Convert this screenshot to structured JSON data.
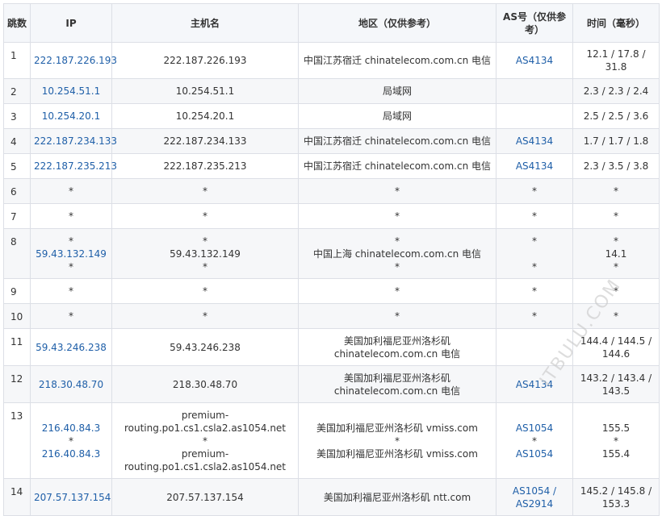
{
  "headers": {
    "hop": "跳数",
    "ip": "IP",
    "host": "主机名",
    "region": "地区（仅供参考）",
    "as": "AS号（仅供参考）",
    "time": "时间（毫秒）"
  },
  "rows": [
    {
      "hop": "1",
      "ip": [
        "222.187.226.193"
      ],
      "host": [
        "222.187.226.193"
      ],
      "region": [
        "中国江苏宿迁 chinatelecom.com.cn 电信"
      ],
      "as": [
        "AS4134"
      ],
      "time": [
        "12.1 / 17.8 / 31.8"
      ]
    },
    {
      "hop": "2",
      "ip": [
        "10.254.51.1"
      ],
      "host": [
        "10.254.51.1"
      ],
      "region": [
        "局域网"
      ],
      "as": [
        ""
      ],
      "time": [
        "2.3 / 2.3 / 2.4"
      ]
    },
    {
      "hop": "3",
      "ip": [
        "10.254.20.1"
      ],
      "host": [
        "10.254.20.1"
      ],
      "region": [
        "局域网"
      ],
      "as": [
        ""
      ],
      "time": [
        "2.5 / 2.5 / 3.6"
      ]
    },
    {
      "hop": "4",
      "ip": [
        "222.187.234.133"
      ],
      "host": [
        "222.187.234.133"
      ],
      "region": [
        "中国江苏宿迁 chinatelecom.com.cn 电信"
      ],
      "as": [
        "AS4134"
      ],
      "time": [
        "1.7 / 1.7 / 1.8"
      ]
    },
    {
      "hop": "5",
      "ip": [
        "222.187.235.213"
      ],
      "host": [
        "222.187.235.213"
      ],
      "region": [
        "中国江苏宿迁 chinatelecom.com.cn 电信"
      ],
      "as": [
        "AS4134"
      ],
      "time": [
        "2.3 / 3.5 / 3.8"
      ]
    },
    {
      "hop": "6",
      "ip": [
        "*"
      ],
      "host": [
        "*"
      ],
      "region": [
        "*"
      ],
      "as": [
        "*"
      ],
      "time": [
        "*"
      ]
    },
    {
      "hop": "7",
      "ip": [
        "*"
      ],
      "host": [
        "*"
      ],
      "region": [
        "*"
      ],
      "as": [
        "*"
      ],
      "time": [
        "*"
      ]
    },
    {
      "hop": "8",
      "ip": [
        "*",
        "59.43.132.149",
        "*"
      ],
      "host": [
        "*",
        "59.43.132.149",
        "*"
      ],
      "region": [
        "*",
        "中国上海 chinatelecom.com.cn 电信",
        "*"
      ],
      "as": [
        "*",
        "",
        "*"
      ],
      "time": [
        "*",
        "14.1",
        "*"
      ]
    },
    {
      "hop": "9",
      "ip": [
        "*"
      ],
      "host": [
        "*"
      ],
      "region": [
        "*"
      ],
      "as": [
        "*"
      ],
      "time": [
        "*"
      ]
    },
    {
      "hop": "10",
      "ip": [
        "*"
      ],
      "host": [
        "*"
      ],
      "region": [
        "*"
      ],
      "as": [
        "*"
      ],
      "time": [
        "*"
      ]
    },
    {
      "hop": "11",
      "ip": [
        "59.43.246.238"
      ],
      "host": [
        "59.43.246.238"
      ],
      "region": [
        "美国加利福尼亚州洛杉矶",
        "chinatelecom.com.cn 电信"
      ],
      "as": [
        ""
      ],
      "time": [
        "144.4 / 144.5 /",
        "144.6"
      ]
    },
    {
      "hop": "12",
      "ip": [
        "218.30.48.70"
      ],
      "host": [
        "218.30.48.70"
      ],
      "region": [
        "美国加利福尼亚州洛杉矶",
        "chinatelecom.com.cn 电信"
      ],
      "as": [
        "AS4134"
      ],
      "time": [
        "143.2 / 143.4 /",
        "143.5"
      ]
    },
    {
      "hop": "13",
      "ip": [
        "216.40.84.3",
        "*",
        "216.40.84.3"
      ],
      "host": [
        "premium-",
        "routing.po1.cs1.csla2.as1054.net",
        "*",
        "premium-",
        "routing.po1.cs1.csla2.as1054.net"
      ],
      "region": [
        "美国加利福尼亚州洛杉矶 vmiss.com",
        "*",
        "美国加利福尼亚州洛杉矶 vmiss.com"
      ],
      "as": [
        "AS1054",
        "*",
        "AS1054"
      ],
      "time": [
        "155.5",
        "*",
        "155.4"
      ]
    },
    {
      "hop": "14",
      "ip": [
        "207.57.137.154"
      ],
      "host": [
        "207.57.137.154"
      ],
      "region": [
        "美国加利福尼亚州洛杉矶 ntt.com"
      ],
      "as": [
        "AS1054 /",
        "AS2914"
      ],
      "time": [
        "145.2 / 145.8 /",
        "153.3"
      ]
    }
  ],
  "watermark": "ITBULU.COM"
}
